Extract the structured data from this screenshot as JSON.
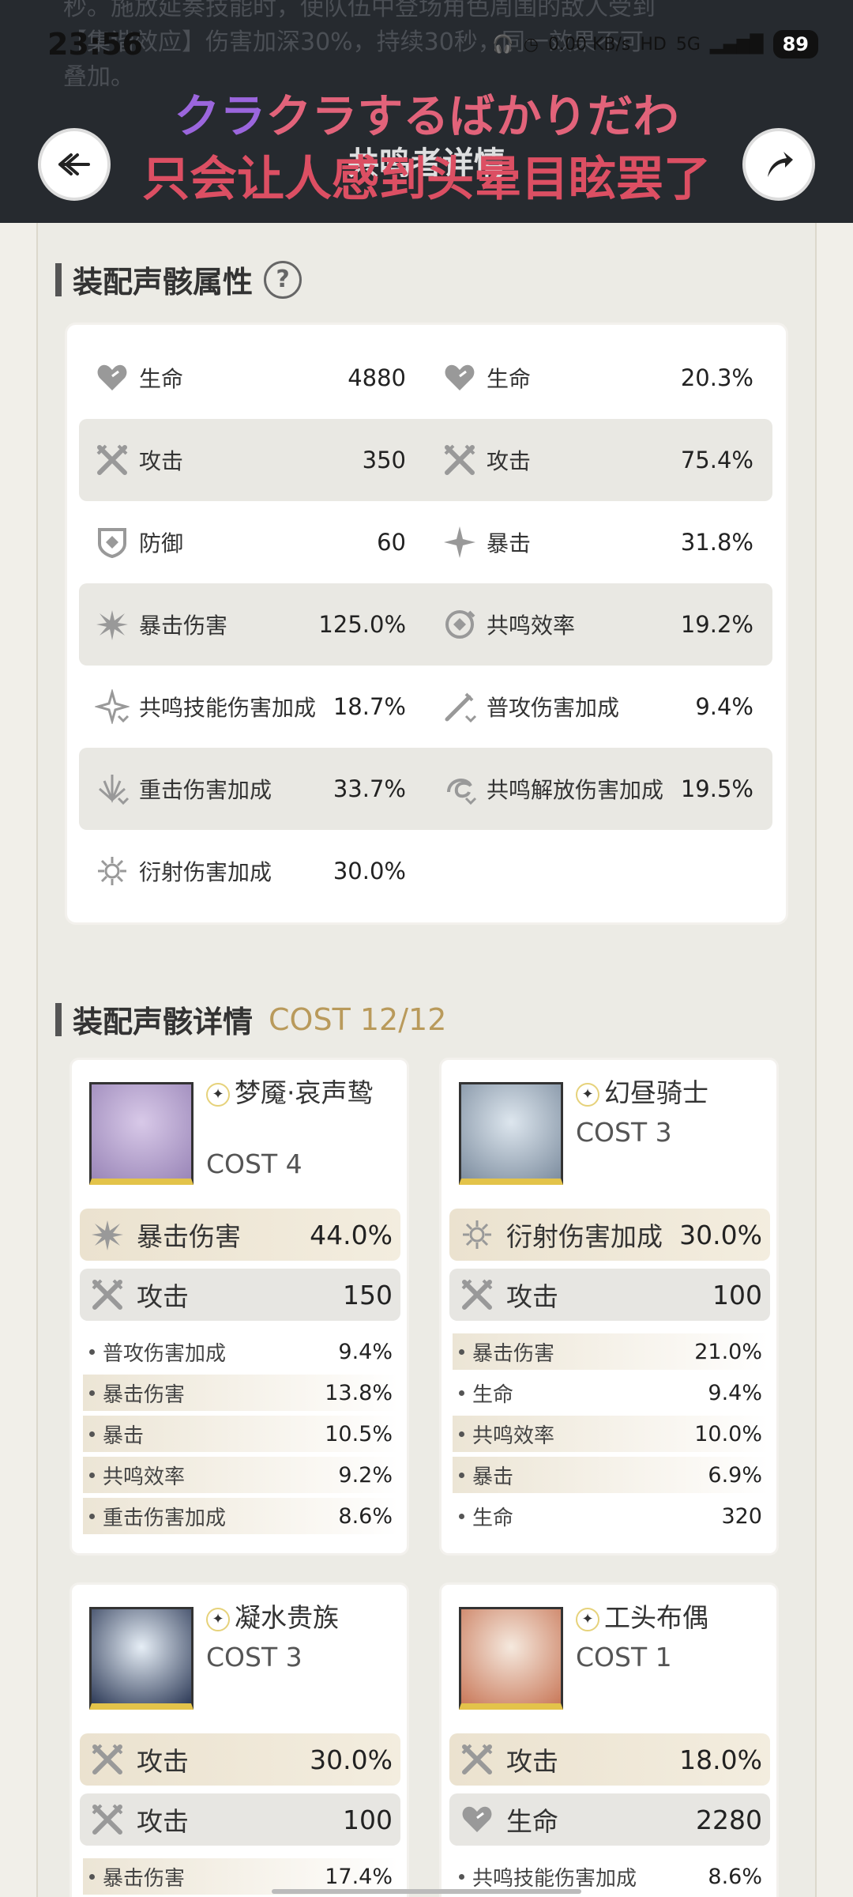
{
  "status": {
    "time": "23:56",
    "net": "0.00 KB/s",
    "signal": "5G",
    "hd": "HD",
    "battery": "89"
  },
  "ghost": {
    "line1": "秒。施放延奏技能时，使队伍中登场角色周围的敌人受到",
    "line2": "【集谐效应】伤害加深30%，持续30秒，同一效果不可",
    "line3": "叠加。"
  },
  "subtitle": {
    "line1_purple": "クラ",
    "line1_rest": "クラするばかりだわ",
    "line2": "只会让人感到头晕目眩罢了"
  },
  "header": {
    "title": "共鸣者详情"
  },
  "sections": {
    "attr_title": "装配声骸属性",
    "help": "?",
    "detail_title": "装配声骸详情",
    "cost_text": "COST 12/12"
  },
  "attributes": [
    {
      "left": {
        "label": "生命",
        "value": "4880",
        "icon": "heart-icon"
      },
      "right": {
        "label": "生命",
        "value": "20.3%",
        "icon": "heart-icon"
      }
    },
    {
      "left": {
        "label": "攻击",
        "value": "350",
        "icon": "crossed-swords-icon"
      },
      "right": {
        "label": "攻击",
        "value": "75.4%",
        "icon": "crossed-swords-icon"
      }
    },
    {
      "left": {
        "label": "防御",
        "value": "60",
        "icon": "shield-icon"
      },
      "right": {
        "label": "暴击",
        "value": "31.8%",
        "icon": "crit-star-icon"
      }
    },
    {
      "left": {
        "label": "暴击伤害",
        "value": "125.0%",
        "icon": "crit-burst-icon"
      },
      "right": {
        "label": "共鸣效率",
        "value": "19.2%",
        "icon": "energy-regen-icon"
      }
    },
    {
      "left": {
        "label": "共鸣技能伤害加成",
        "value": "18.7%",
        "icon": "skill-dmg-icon"
      },
      "right": {
        "label": "普攻伤害加成",
        "value": "9.4%",
        "icon": "basic-attack-icon"
      }
    },
    {
      "left": {
        "label": "重击伤害加成",
        "value": "33.7%",
        "icon": "heavy-attack-icon"
      },
      "right": {
        "label": "共鸣解放伤害加成",
        "value": "19.5%",
        "icon": "liberation-icon"
      }
    },
    {
      "left": {
        "label": "衍射伤害加成",
        "value": "30.0%",
        "icon": "spectro-icon"
      }
    }
  ],
  "echoes": [
    {
      "name": "梦魇·哀声鸷",
      "cost": "COST 4",
      "main": [
        {
          "label": "暴击伤害",
          "value": "44.0%"
        },
        {
          "label": "攻击",
          "value": "150"
        }
      ],
      "subs": [
        {
          "label": "普攻伤害加成",
          "value": "9.4%"
        },
        {
          "label": "暴击伤害",
          "value": "13.8%"
        },
        {
          "label": "暴击",
          "value": "10.5%"
        },
        {
          "label": "共鸣效率",
          "value": "9.2%"
        },
        {
          "label": "重击伤害加成",
          "value": "8.6%"
        }
      ]
    },
    {
      "name": "幻昼骑士",
      "cost": "COST 3",
      "main": [
        {
          "label": "衍射伤害加成",
          "value": "30.0%"
        },
        {
          "label": "攻击",
          "value": "100"
        }
      ],
      "subs": [
        {
          "label": "暴击伤害",
          "value": "21.0%"
        },
        {
          "label": "生命",
          "value": "9.4%"
        },
        {
          "label": "共鸣效率",
          "value": "10.0%"
        },
        {
          "label": "暴击",
          "value": "6.9%"
        },
        {
          "label": "生命",
          "value": "320"
        }
      ]
    },
    {
      "name": "凝水贵族",
      "cost": "COST 3",
      "main": [
        {
          "label": "攻击",
          "value": "30.0%"
        },
        {
          "label": "攻击",
          "value": "100"
        }
      ],
      "subs": [
        {
          "label": "暴击伤害",
          "value": "17.4%"
        }
      ]
    },
    {
      "name": "工头布偶",
      "cost": "COST 1",
      "main": [
        {
          "label": "攻击",
          "value": "18.0%"
        },
        {
          "label": "生命",
          "value": "2280"
        }
      ],
      "subs": [
        {
          "label": "共鸣技能伤害加成",
          "value": "8.6%"
        }
      ]
    }
  ]
}
